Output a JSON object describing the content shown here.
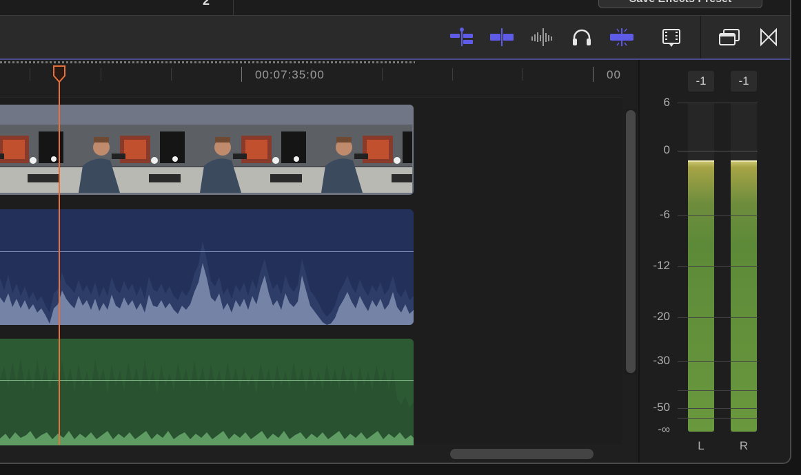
{
  "topbar": {
    "glyph": "2",
    "preset_button": "Save Effects Preset"
  },
  "toolbar": {
    "icons": [
      "clip-appearance-icon",
      "snapping-icon",
      "audio-skimming-icon",
      "solo-icon",
      "skimming-icon",
      "film-strip-icon",
      "window-icon",
      "transition-icon"
    ],
    "accent": "#5e5ce6"
  },
  "timeline": {
    "timecodes": [
      "00:07:35:00",
      "00"
    ],
    "playhead_color": "#e8703a",
    "clips": {
      "video": "#6e7482",
      "dialogue_audio": "#22305a",
      "music_audio": "#2c5a33"
    }
  },
  "meters": {
    "peaks": [
      "-1",
      "-1"
    ],
    "scale": [
      "6",
      "0",
      "-6",
      "-12",
      "-20",
      "-30",
      "-50",
      "-∞"
    ],
    "channels": [
      "L",
      "R"
    ],
    "levels_db": [
      -1,
      -1
    ]
  }
}
